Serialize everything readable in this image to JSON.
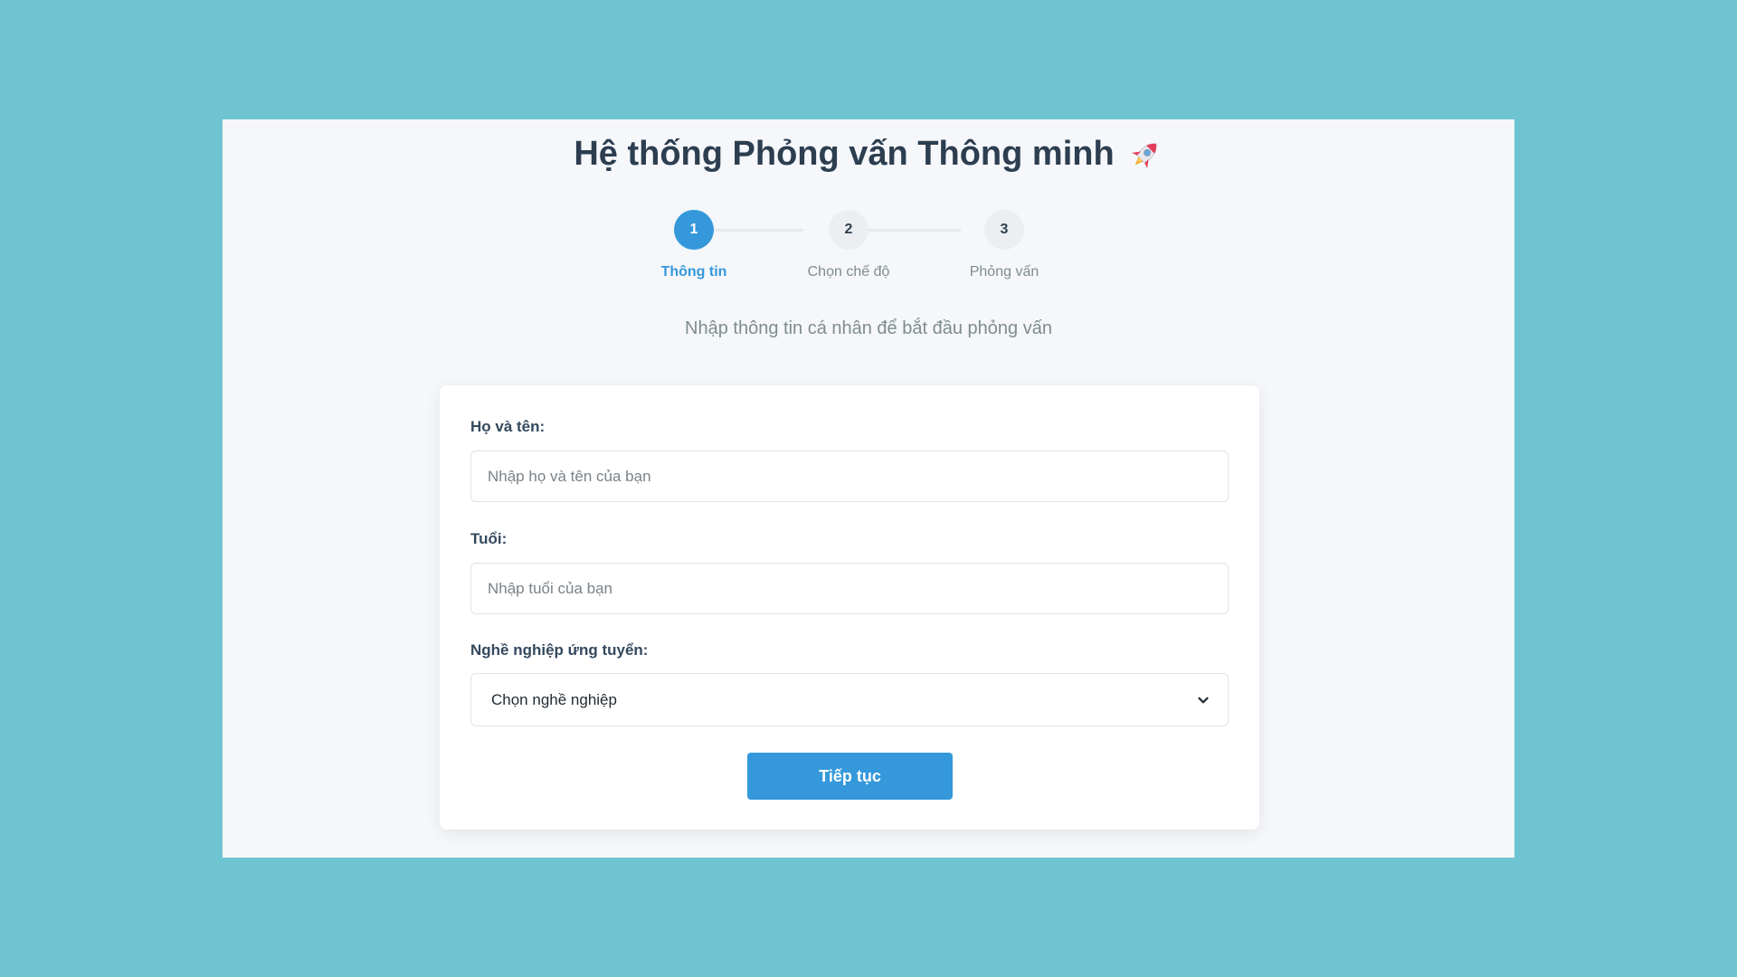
{
  "header": {
    "title": "Hệ thống Phỏng vấn Thông minh",
    "title_icon": "rocket-icon"
  },
  "stepper": {
    "current_step": 1,
    "steps": [
      {
        "number": "1",
        "label": "Thông tin",
        "active": true
      },
      {
        "number": "2",
        "label": "Chọn chế độ",
        "active": false
      },
      {
        "number": "3",
        "label": "Phỏng vấn",
        "active": false
      }
    ]
  },
  "subtitle": "Nhập thông tin cá nhân để bắt đầu phỏng vấn",
  "form": {
    "name": {
      "label": "Họ và tên:",
      "value": "",
      "placeholder": "Nhập họ và tên của bạn"
    },
    "age": {
      "label": "Tuổi:",
      "value": "",
      "placeholder": "Nhập tuổi của bạn"
    },
    "occupation": {
      "label": "Nghề nghiệp ứng tuyển:",
      "selected": "Chọn nghề nghiệp",
      "icon": "chevron-down-icon"
    },
    "submit_label": "Tiếp tục"
  },
  "colors": {
    "background": "#6ec5d1",
    "page": "#f5f7fa",
    "accent": "#3498db",
    "title": "#2c3e50",
    "muted": "#7f8c8d"
  }
}
